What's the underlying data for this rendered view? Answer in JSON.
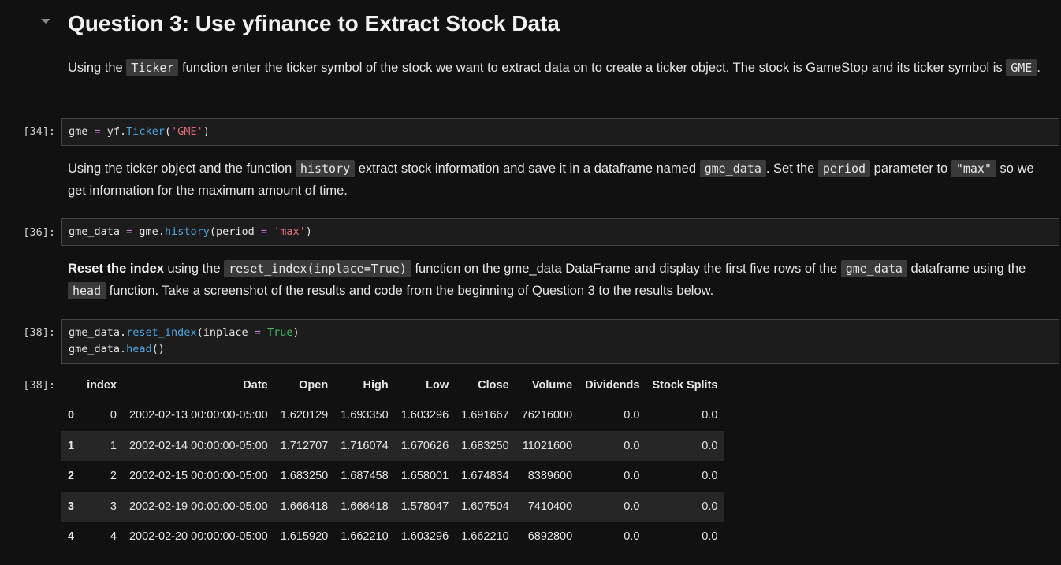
{
  "heading": "Question 3: Use yfinance to Extract Stock Data",
  "p1": {
    "t1": "Using the ",
    "c1": "Ticker",
    "t2": " function enter the ticker symbol of the stock we want to extract data on to create a ticker object. The stock is GameStop and its ticker symbol is ",
    "c2": "GME",
    "t3": "."
  },
  "cell34": {
    "prompt": "[34]:",
    "parts": [
      "gme ",
      "=",
      " yf.",
      "Ticker",
      "(",
      "'GME'",
      ")"
    ]
  },
  "p2": {
    "t1": "Using the ticker object and the function ",
    "c1": "history",
    "t2": " extract stock information and save it in a dataframe named ",
    "c2": "gme_data",
    "t3": ". Set the ",
    "c3": "period",
    "t4": " parameter to ",
    "c4": "\"max\"",
    "t5": " so we get information for the maximum amount of time."
  },
  "cell36": {
    "prompt": "[36]:",
    "parts": [
      "gme_data ",
      "=",
      " gme.",
      "history",
      "(period ",
      "=",
      " ",
      "'max'",
      ")"
    ]
  },
  "p3": {
    "b1": "Reset the index",
    "t1": " using the ",
    "c1": "reset_index(inplace=True)",
    "t2": " function on the gme_data DataFrame and display the first five rows of the ",
    "c2": "gme_data",
    "t3": " dataframe using the ",
    "c3": "head",
    "t4": " function. Take a screenshot of the results and code from the beginning of Question 3 to the results below."
  },
  "cell38": {
    "prompt": "[38]:",
    "line1": [
      "gme_data.",
      "reset_index",
      "(inplace ",
      "=",
      " ",
      "True",
      ")"
    ],
    "line2": [
      "gme_data.",
      "head",
      "()"
    ]
  },
  "out38": {
    "prompt": "[38]:",
    "columns": [
      "",
      "index",
      "Date",
      "Open",
      "High",
      "Low",
      "Close",
      "Volume",
      "Dividends",
      "Stock Splits"
    ],
    "rows": [
      [
        "0",
        "0",
        "2002-02-13 00:00:00-05:00",
        "1.620129",
        "1.693350",
        "1.603296",
        "1.691667",
        "76216000",
        "0.0",
        "0.0"
      ],
      [
        "1",
        "1",
        "2002-02-14 00:00:00-05:00",
        "1.712707",
        "1.716074",
        "1.670626",
        "1.683250",
        "11021600",
        "0.0",
        "0.0"
      ],
      [
        "2",
        "2",
        "2002-02-15 00:00:00-05:00",
        "1.683250",
        "1.687458",
        "1.658001",
        "1.674834",
        "8389600",
        "0.0",
        "0.0"
      ],
      [
        "3",
        "3",
        "2002-02-19 00:00:00-05:00",
        "1.666418",
        "1.666418",
        "1.578047",
        "1.607504",
        "7410400",
        "0.0",
        "0.0"
      ],
      [
        "4",
        "4",
        "2002-02-20 00:00:00-05:00",
        "1.615920",
        "1.662210",
        "1.603296",
        "1.662210",
        "6892800",
        "0.0",
        "0.0"
      ]
    ]
  }
}
